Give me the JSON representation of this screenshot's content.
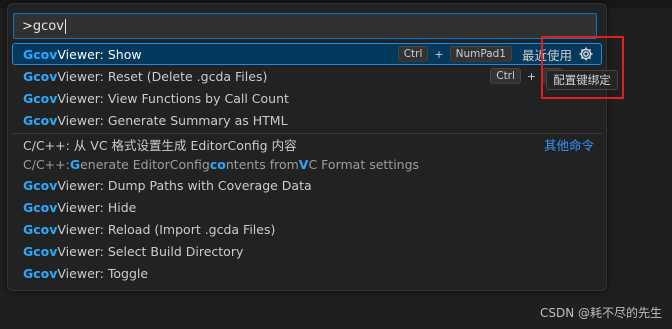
{
  "input": {
    "value": ">gcov"
  },
  "items": [
    {
      "prefix": "Gcov",
      "rest": " Viewer: Show",
      "selected": true,
      "keys": [
        "Ctrl",
        "NumPad1"
      ],
      "recent": "最近使用"
    },
    {
      "prefix": "Gcov",
      "rest": " Viewer: Reset (Delete .gcda Files)",
      "keys": [
        "Ctrl",
        "N"
      ]
    },
    {
      "prefix": "Gcov",
      "rest": " Viewer: View Functions by Call Count"
    },
    {
      "prefix": "Gcov",
      "rest": " Viewer: Generate Summary as HTML"
    },
    {
      "title": "C/C++: 从 VC 格式设置生成 EditorConfig 内容",
      "other": "其他命令",
      "subtitle": {
        "p1": "C/C++: ",
        "h1": "G",
        "p2": "enerate EditorConfig ",
        "h2": "co",
        "p3": "ntents from ",
        "h3": "V",
        "p4": "C Format settings"
      }
    },
    {
      "prefix": "Gcov",
      "rest": " Viewer: Dump Paths with Coverage Data"
    },
    {
      "prefix": "Gcov",
      "rest": " Viewer: Hide"
    },
    {
      "prefix": "Gcov",
      "rest": " Viewer: Reload (Import .gcda Files)"
    },
    {
      "prefix": "Gcov",
      "rest": " Viewer: Select Build Directory"
    },
    {
      "prefix": "Gcov",
      "rest": " Viewer: Toggle"
    }
  ],
  "tooltip": "配置键绑定",
  "watermark": "CSDN @耗不尽的先生",
  "keybinding_plus": "+",
  "icons": {
    "gear": "gear-icon"
  },
  "colors": {
    "highlight": "#2aaaff",
    "selection": "#04395e",
    "annotation": "#e02020"
  }
}
